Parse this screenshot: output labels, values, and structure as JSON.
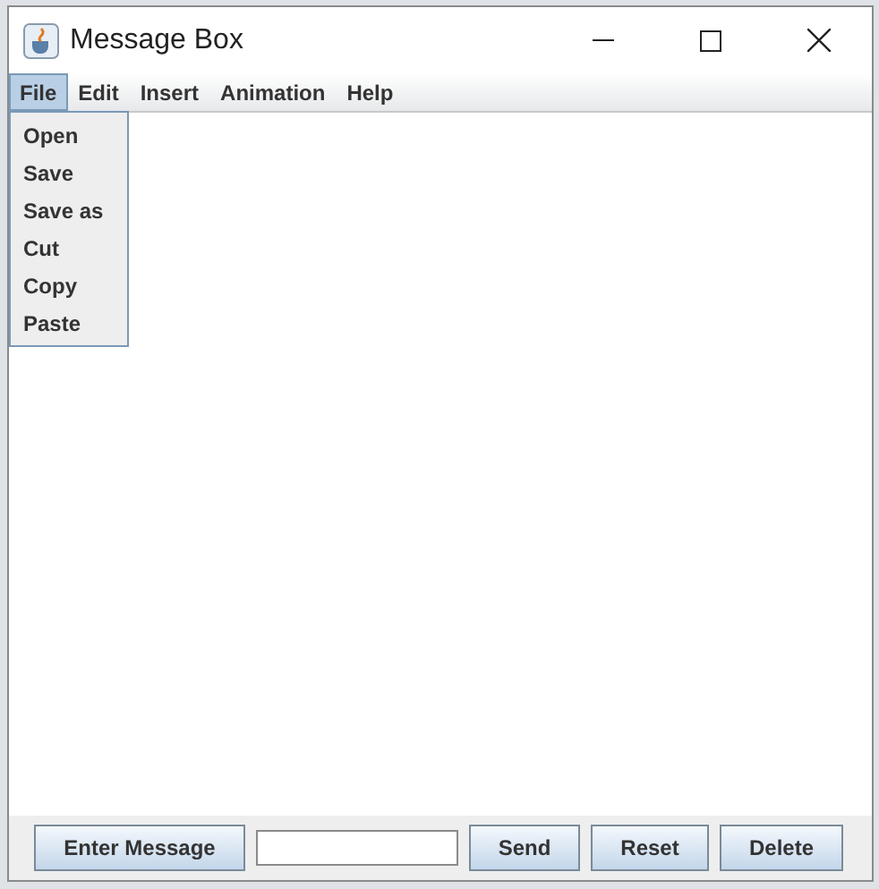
{
  "window": {
    "title": "Message Box"
  },
  "menu_bar": [
    {
      "label": "File",
      "selected": true
    },
    {
      "label": "Edit",
      "selected": false
    },
    {
      "label": "Insert",
      "selected": false
    },
    {
      "label": "Animation",
      "selected": false
    },
    {
      "label": "Help",
      "selected": false
    }
  ],
  "dropdown": {
    "items": [
      "Open",
      "Save",
      "Save as",
      "Cut",
      "Copy",
      "Paste"
    ]
  },
  "bottom_bar": {
    "buttons_left": [
      "Enter Message"
    ],
    "buttons_right": [
      "Send",
      "Reset",
      "Delete"
    ]
  }
}
